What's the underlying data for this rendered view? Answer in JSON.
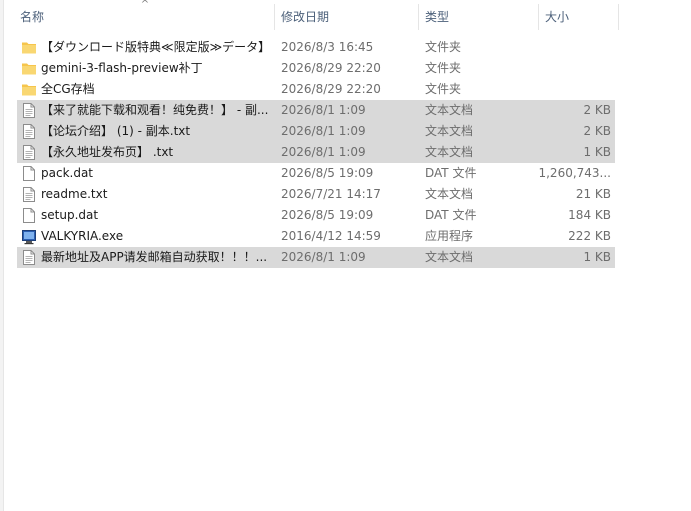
{
  "columns": {
    "name": "名称",
    "date": "修改日期",
    "type": "类型",
    "size": "大小"
  },
  "sort_indicator": "^",
  "files": [
    {
      "name": "【ダウンロード版特典≪限定版≫データ】",
      "date": "2026/8/3 16:45",
      "type": "文件夹",
      "size": "",
      "icon": "folder-icon",
      "selected": false
    },
    {
      "name": "gemini-3-flash-preview补丁",
      "date": "2026/8/29 22:20",
      "type": "文件夹",
      "size": "",
      "icon": "folder-icon",
      "selected": false
    },
    {
      "name": "全CG存档",
      "date": "2026/8/29 22:20",
      "type": "文件夹",
      "size": "",
      "icon": "folder-icon",
      "selected": false
    },
    {
      "name": "【来了就能下载和观看！纯免费！】 - 副...",
      "date": "2026/8/1 1:09",
      "type": "文本文档",
      "size": "2 KB",
      "icon": "text-file-icon",
      "selected": true
    },
    {
      "name": "【论坛介绍】 (1) - 副本.txt",
      "date": "2026/8/1 1:09",
      "type": "文本文档",
      "size": "2 KB",
      "icon": "text-file-icon",
      "selected": true
    },
    {
      "name": "【永久地址发布页】 .txt",
      "date": "2026/8/1 1:09",
      "type": "文本文档",
      "size": "1 KB",
      "icon": "text-file-icon",
      "selected": true
    },
    {
      "name": "pack.dat",
      "date": "2026/8/5 19:09",
      "type": "DAT 文件",
      "size": "1,260,743...",
      "icon": "file-icon",
      "selected": false
    },
    {
      "name": "readme.txt",
      "date": "2026/7/21 14:17",
      "type": "文本文档",
      "size": "21 KB",
      "icon": "text-file-icon",
      "selected": false
    },
    {
      "name": "setup.dat",
      "date": "2026/8/5 19:09",
      "type": "DAT 文件",
      "size": "184 KB",
      "icon": "file-icon",
      "selected": false
    },
    {
      "name": "VALKYRIA.exe",
      "date": "2016/4/12 14:59",
      "type": "应用程序",
      "size": "222 KB",
      "icon": "application-icon",
      "selected": false
    },
    {
      "name": "最新地址及APP请发邮箱自动获取！！！...",
      "date": "2026/8/1 1:09",
      "type": "文本文档",
      "size": "1 KB",
      "icon": "text-file-icon",
      "selected": true
    }
  ],
  "colors": {
    "header_text": "#4c607a",
    "selection": "#d9d9d9",
    "folder": "#f6c54c",
    "secondary_text": "#6d6d6d"
  }
}
